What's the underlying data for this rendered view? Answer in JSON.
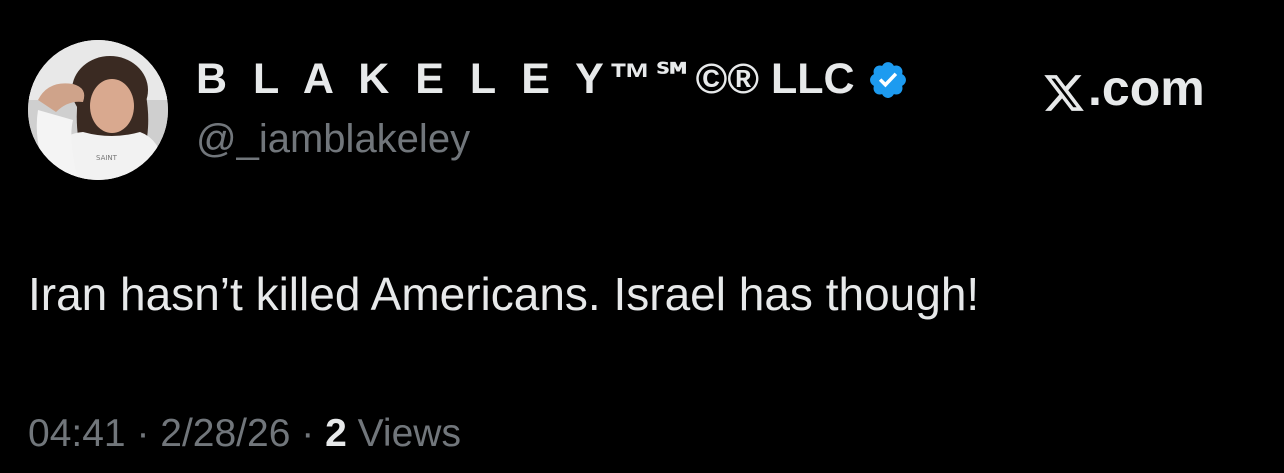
{
  "author": {
    "display_name": "B L A K E L E Y",
    "display_name_suffix": "™℠©® LLC",
    "handle": "@_iamblakeley",
    "verified_color": "#1d9bf0",
    "avatar": "profile-photo"
  },
  "brand": {
    "label": ".com",
    "logo": "x-logo-icon"
  },
  "tweet": {
    "text": "Iran hasn’t killed Americans. Israel has though!"
  },
  "meta": {
    "time": "04:41",
    "separator1": " · ",
    "date": "2/28/26",
    "separator2": " · ",
    "views_count": "2",
    "views_label": " Views"
  },
  "colors": {
    "background": "#000000",
    "primary_text": "#e7e9ea",
    "secondary_text": "#71767b",
    "verified_blue": "#1d9bf0"
  }
}
